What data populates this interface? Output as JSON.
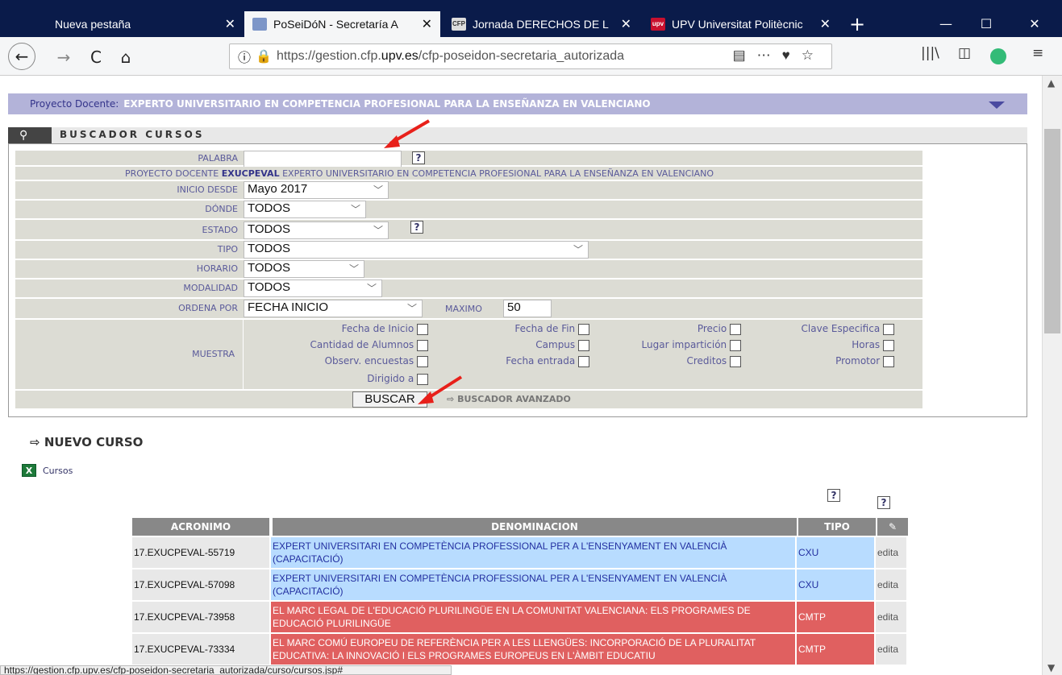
{
  "browser": {
    "tabs": [
      {
        "label": "Nueva pestaña",
        "active": false
      },
      {
        "label": "PoSeiDóN - Secretaría A",
        "active": true
      },
      {
        "label": "Jornada DERECHOS DE L",
        "active": false
      },
      {
        "label": "UPV Universitat Politècnic",
        "active": false
      }
    ],
    "favicons": {
      "tab3": "CFP",
      "tab4": "upv"
    },
    "url_prefix": "https://gestion.cfp.",
    "url_domain": "upv.es",
    "url_rest": "/cfp-poseidon-secretaria_autorizada",
    "status_url": "https://gestion.cfp.upv.es/cfp-poseidon-secretaria_autorizada/curso/cursos.jsp#"
  },
  "project": {
    "label": "Proyecto Docente:",
    "value": "EXPERTO UNIVERSITARIO EN COMPETENCIA PROFESIONAL PARA LA ENSEÑANZA EN VALENCIANO"
  },
  "search": {
    "title": "BUSCADOR CURSOS",
    "palabra_label": "PALABRA",
    "palabra_value": "",
    "proyecto_label": "PROYECTO DOCENTE",
    "proyecto_code": "EXUCPEVAL",
    "proyecto_name": "EXPERTO UNIVERSITARIO EN COMPETENCIA PROFESIONAL PARA LA ENSEÑANZA EN VALENCIANO",
    "inicio_label": "INICIO DESDE",
    "inicio_value": "Mayo 2017",
    "donde_label": "DÓNDE",
    "donde_value": "TODOS",
    "estado_label": "ESTADO",
    "estado_value": "TODOS",
    "tipo_label": "TIPO",
    "tipo_value": "TODOS",
    "horario_label": "HORARIO",
    "horario_value": "TODOS",
    "modalidad_label": "MODALIDAD",
    "modalidad_value": "TODOS",
    "ordena_label": "ORDENA POR",
    "ordena_value": "FECHA INICIO",
    "maximo_label": "MAXIMO",
    "maximo_value": "50",
    "muestra_label": "MUESTRA",
    "checks": [
      "Fecha de Inicio",
      "Fecha de Fin",
      "Precio",
      "Clave Especifica",
      "Cantidad de Alumnos",
      "Campus",
      "Lugar impartición",
      "Horas",
      "Observ. encuestas",
      "Fecha entrada",
      "Creditos",
      "Promotor",
      "Dirigido a"
    ],
    "buscar_label": "BUSCAR",
    "avanzado_label": "BUSCADOR AVANZADO",
    "help_glyph": "?"
  },
  "nuevo_label": "NUEVO CURSO",
  "xls_label": "Cursos",
  "table": {
    "headers": [
      "ACRONIMO",
      "DENOMINACION",
      "TIPO"
    ],
    "edit_label": "edita",
    "rows": [
      {
        "acr": "17.EXUCPEVAL-55719",
        "den": "EXPERT UNIVERSITARI EN COMPETÈNCIA PROFESSIONAL PER A L'ENSENYAMENT EN VALENCIÀ (CAPACITACIÓ)",
        "tipo": "CXU",
        "color": "blue"
      },
      {
        "acr": "17.EXUCPEVAL-57098",
        "den": "EXPERT UNIVERSITARI EN COMPETÈNCIA PROFESSIONAL PER A L'ENSENYAMENT EN VALENCIÀ (CAPACITACIÓ)",
        "tipo": "CXU",
        "color": "blue"
      },
      {
        "acr": "17.EXUCPEVAL-73958",
        "den": "EL MARC LEGAL DE L'EDUCACIÓ PLURILINGÜE EN LA COMUNITAT VALENCIANA: ELS PROGRAMES DE EDUCACIÓ PLURILINGÜE",
        "tipo": "CMTP",
        "color": "red"
      },
      {
        "acr": "17.EXUCPEVAL-73334",
        "den": "EL MARC COMÚ EUROPEU DE REFERÈNCIA PER A LES LLENGÜES: INCORPORACIÓ DE LA PLURALITAT EDUCATIVA: LA INNOVACIÓ I ELS PROGRAMES EUROPEUS EN L'ÀMBIT EDUCATIU",
        "tipo": "CMTP",
        "color": "red"
      }
    ]
  },
  "colors": {
    "annotation_arrow": "#e8201a",
    "project_bar": "#b3b3d9",
    "row_blue": "#b8dcff",
    "row_red": "#e06060"
  }
}
